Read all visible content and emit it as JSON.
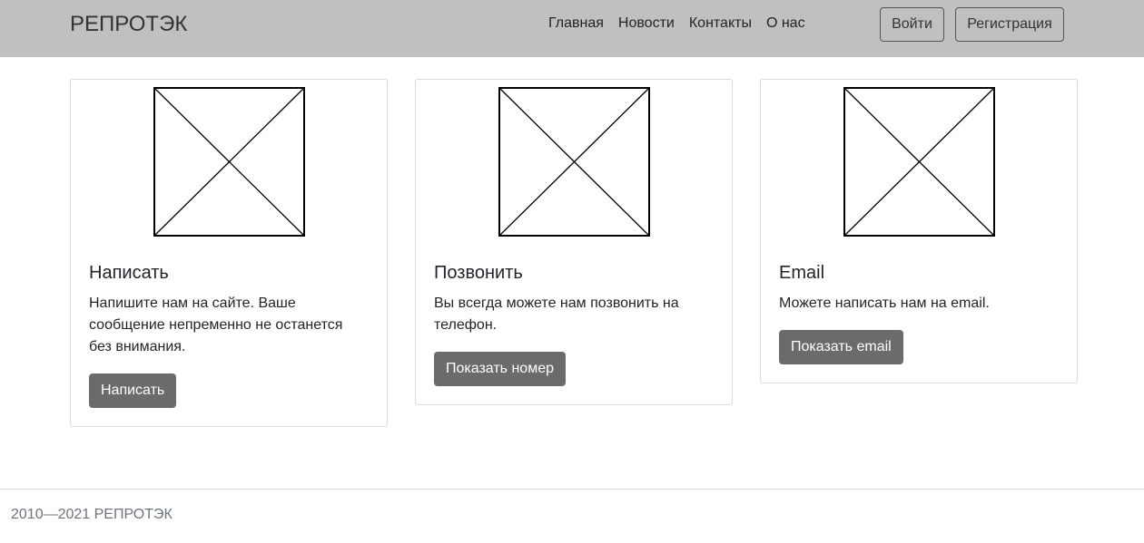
{
  "header": {
    "brand": "РЕПРОТЭК",
    "nav": [
      "Главная",
      "Новости",
      "Контакты",
      "О нас"
    ],
    "login_label": "Войти",
    "signup_label": "Регистрация"
  },
  "cards": [
    {
      "title": "Написать",
      "text": "Напишите нам на сайте. Ваше сообщение непременно не останется без внимания.",
      "button": "Написать",
      "image_icon": "image-placeholder-icon"
    },
    {
      "title": "Позвонить",
      "text": "Вы всегда можете нам позвонить на телефон.",
      "button": "Показать номер",
      "image_icon": "image-placeholder-icon"
    },
    {
      "title": "Email",
      "text": "Можете написать нам на email.",
      "button": "Показать email",
      "image_icon": "image-placeholder-icon"
    }
  ],
  "footer": {
    "copyright": "2010—2021 РЕПРОТЭК"
  },
  "colors": {
    "navbar_bg": "#c0c0c0",
    "card_button_bg": "#6b6b6b",
    "footer_text": "#6c757d"
  }
}
